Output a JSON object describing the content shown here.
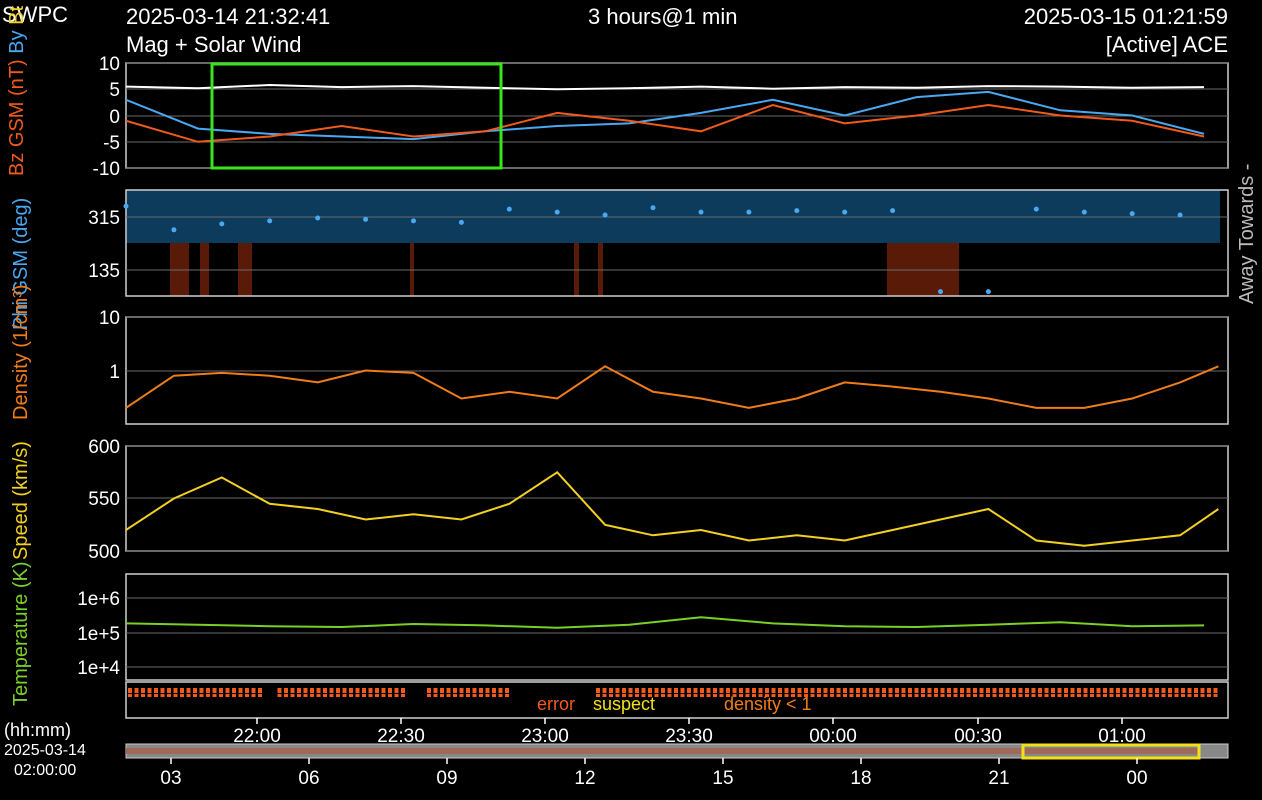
{
  "header": {
    "org": "SWPC",
    "start_time": "2025-03-14 21:32:41",
    "span": "3 hours@1 min",
    "end_time": "2025-03-15 01:21:59",
    "plot_title": "Mag + Solar Wind",
    "source": "[Active] ACE"
  },
  "colors": {
    "bz": "#f05a1c",
    "by": "#4aa8f0",
    "bt": "#ffffff",
    "phi": "#4aa8f0",
    "density": "#f07d1a",
    "speed": "#f2d024",
    "temperature": "#7ad02a",
    "frame": "#cfcfcf",
    "select": "#39e61a",
    "nav": "#f2e01a",
    "phi_away": "#0d3b5c",
    "phi_towards": "#5a1a08"
  },
  "panel_labels": {
    "mag": [
      "Bz GSM (nT)",
      "By",
      "Bt"
    ],
    "phi": "Phi GSM (deg)",
    "phi_side": [
      "Away",
      "Towards -"
    ],
    "density": "Density (1/cm³)",
    "speed": "Speed (km/s)",
    "temperature": "Temperature (K)"
  },
  "legend": {
    "error": "error",
    "suspect": "suspect",
    "density_low": "density < 1"
  },
  "time_axis": {
    "unit_label": "(hh:mm)",
    "ticks": [
      "22:00",
      "22:30",
      "23:00",
      "23:30",
      "00:00",
      "00:30",
      "01:00"
    ]
  },
  "navigator": {
    "date": "2025-03-14",
    "time": "02:00:00",
    "ticks": [
      "03",
      "06",
      "09",
      "12",
      "15",
      "18",
      "21",
      "00"
    ]
  },
  "chart_data": [
    {
      "type": "line",
      "name": "mag",
      "ylabel": "Bz GSM (nT)",
      "ylim": [
        -10,
        10
      ],
      "yticks": [
        "10",
        "5",
        "0",
        "-5",
        "-10"
      ],
      "x_minutes": [
        0,
        15,
        30,
        45,
        60,
        75,
        90,
        105,
        120,
        135,
        150,
        165,
        180,
        195,
        210,
        225
      ],
      "series": [
        {
          "name": "Bt",
          "values": [
            5.5,
            5.2,
            5.8,
            5.4,
            5.6,
            5.3,
            5.0,
            5.2,
            5.5,
            5.1,
            5.4,
            5.3,
            5.6,
            5.5,
            5.3,
            5.4
          ]
        },
        {
          "name": "By",
          "values": [
            3.0,
            -2.5,
            -3.5,
            -4.0,
            -4.5,
            -3.0,
            -2.0,
            -1.5,
            0.5,
            3.0,
            0.0,
            3.5,
            4.5,
            1.0,
            0.0,
            -3.5
          ]
        },
        {
          "name": "Bz",
          "values": [
            -1.0,
            -5.0,
            -4.0,
            -2.0,
            -4.0,
            -3.0,
            0.5,
            -1.0,
            -3.0,
            2.0,
            -1.5,
            0.0,
            2.0,
            0.0,
            -1.0,
            -4.0
          ]
        }
      ]
    },
    {
      "type": "scatter",
      "name": "phi",
      "ylabel": "Phi GSM (deg)",
      "ylim": [
        45,
        405
      ],
      "yticks": [
        "315",
        "135"
      ],
      "x_minutes": [
        0,
        10,
        20,
        30,
        40,
        50,
        60,
        70,
        80,
        90,
        100,
        110,
        120,
        130,
        140,
        150,
        160,
        170,
        180,
        190,
        200,
        210,
        220
      ],
      "values": [
        350,
        270,
        290,
        300,
        310,
        305,
        300,
        295,
        340,
        330,
        320,
        345,
        330,
        330,
        335,
        330,
        335,
        60,
        60,
        340,
        330,
        325,
        320
      ]
    },
    {
      "type": "line",
      "name": "density",
      "scale": "log",
      "ylabel": "Density (1/cm³)",
      "ylim": [
        0.1,
        10
      ],
      "yticks": [
        "10",
        "1"
      ],
      "x_minutes": [
        0,
        10,
        20,
        30,
        40,
        50,
        60,
        70,
        80,
        90,
        100,
        110,
        120,
        130,
        140,
        150,
        160,
        170,
        180,
        190,
        200,
        210,
        220,
        228
      ],
      "values": [
        0.2,
        0.8,
        0.9,
        0.8,
        0.6,
        1.0,
        0.9,
        0.3,
        0.4,
        0.3,
        1.2,
        0.4,
        0.3,
        0.2,
        0.3,
        0.6,
        0.5,
        0.4,
        0.3,
        0.2,
        0.2,
        0.3,
        0.6,
        1.2
      ]
    },
    {
      "type": "line",
      "name": "speed",
      "ylabel": "Speed (km/s)",
      "ylim": [
        500,
        600
      ],
      "yticks": [
        "600",
        "550",
        "500"
      ],
      "x_minutes": [
        0,
        10,
        20,
        30,
        40,
        50,
        60,
        70,
        80,
        90,
        100,
        110,
        120,
        130,
        140,
        150,
        160,
        170,
        180,
        190,
        200,
        210,
        220,
        228
      ],
      "values": [
        520,
        550,
        570,
        545,
        540,
        530,
        535,
        530,
        545,
        575,
        525,
        515,
        520,
        510,
        515,
        510,
        520,
        530,
        540,
        510,
        505,
        510,
        515,
        540
      ]
    },
    {
      "type": "line",
      "name": "temperature",
      "scale": "log",
      "ylabel": "Temperature (K)",
      "ylim": [
        3000,
        3000000
      ],
      "yticks": [
        "1e+6",
        "1e+5",
        "1e+4"
      ],
      "x_minutes": [
        0,
        15,
        30,
        45,
        60,
        75,
        90,
        105,
        120,
        135,
        150,
        165,
        180,
        195,
        210,
        225
      ],
      "values": [
        120000,
        110000,
        100000,
        95000,
        115000,
        105000,
        90000,
        110000,
        180000,
        120000,
        100000,
        95000,
        110000,
        130000,
        100000,
        105000
      ]
    }
  ]
}
